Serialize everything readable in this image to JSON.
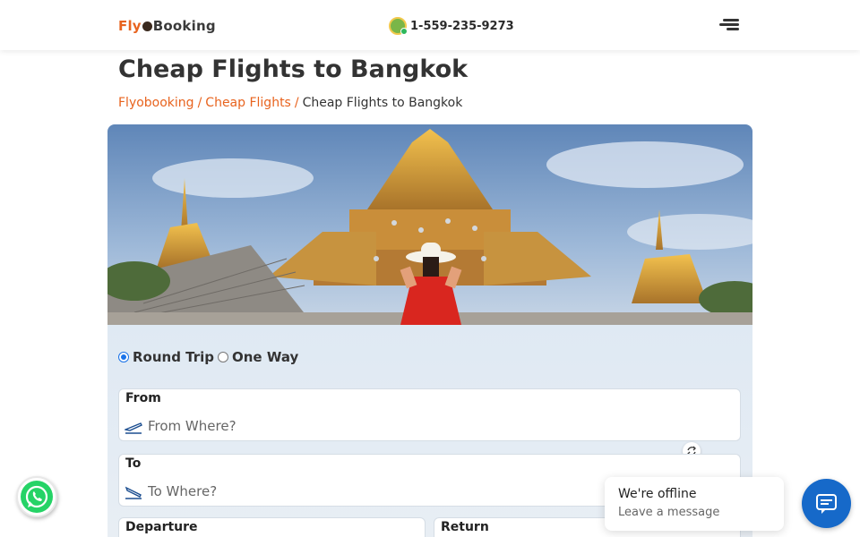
{
  "header": {
    "logo": {
      "part1": "Fly",
      "part2": "Booking"
    },
    "phone": "1-559-235-9273",
    "icons": {
      "agent": "agent-avatar-icon",
      "menu": "hamburger-menu-icon"
    }
  },
  "page": {
    "title": "Cheap Flights to Bangkok",
    "breadcrumb": [
      {
        "label": "Flyobooking",
        "link": true
      },
      {
        "label": "Cheap Flights",
        "link": true
      },
      {
        "label": "Cheap Flights to Bangkok",
        "link": false
      }
    ],
    "hero_alt": "Woman in red dress in front of Thai temple"
  },
  "search": {
    "trip_types": [
      {
        "label": "Round Trip",
        "selected": true
      },
      {
        "label": "One Way",
        "selected": false
      }
    ],
    "from": {
      "label": "From",
      "placeholder": "From Where?",
      "value": ""
    },
    "to": {
      "label": "To",
      "placeholder": "To Where?",
      "value": ""
    },
    "departure": {
      "label": "Departure"
    },
    "return": {
      "label": "Return"
    }
  },
  "chat": {
    "status": "We're offline",
    "subtitle": "Leave a message"
  },
  "colors": {
    "brand_orange": "#e8631e",
    "radio_blue": "#1a73e8",
    "chat_blue": "#1669c9",
    "whatsapp_green": "#25d366"
  }
}
